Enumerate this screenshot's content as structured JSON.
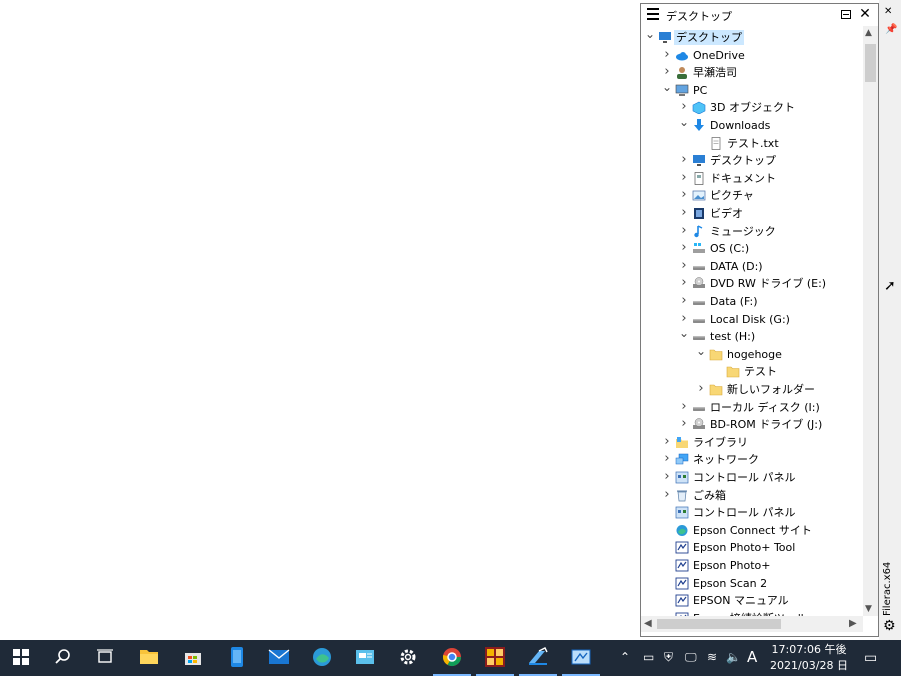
{
  "panel": {
    "title": "デスクトップ"
  },
  "tree": [
    {
      "label": "デスクトップ",
      "depth": 0,
      "chevron": "open",
      "icon": "desktop-icon",
      "selected": true
    },
    {
      "label": "OneDrive",
      "depth": 1,
      "chevron": "closed",
      "icon": "cloud-icon"
    },
    {
      "label": "早瀬浩司",
      "depth": 1,
      "chevron": "closed",
      "icon": "user-icon"
    },
    {
      "label": "PC",
      "depth": 1,
      "chevron": "open",
      "icon": "pc-icon"
    },
    {
      "label": "3D オブジェクト",
      "depth": 2,
      "chevron": "closed",
      "icon": "3d-objects-icon"
    },
    {
      "label": "Downloads",
      "depth": 2,
      "chevron": "open",
      "icon": "download-arrow-icon"
    },
    {
      "label": "テスト.txt",
      "depth": 3,
      "chevron": "none",
      "icon": "text-file-icon"
    },
    {
      "label": "デスクトップ",
      "depth": 2,
      "chevron": "closed",
      "icon": "desktop-icon"
    },
    {
      "label": "ドキュメント",
      "depth": 2,
      "chevron": "closed",
      "icon": "document-icon"
    },
    {
      "label": "ピクチャ",
      "depth": 2,
      "chevron": "closed",
      "icon": "pictures-icon"
    },
    {
      "label": "ビデオ",
      "depth": 2,
      "chevron": "closed",
      "icon": "video-icon"
    },
    {
      "label": "ミュージック",
      "depth": 2,
      "chevron": "closed",
      "icon": "music-icon"
    },
    {
      "label": "OS (C:)",
      "depth": 2,
      "chevron": "closed",
      "icon": "windows-drive-icon"
    },
    {
      "label": "DATA (D:)",
      "depth": 2,
      "chevron": "closed",
      "icon": "drive-icon"
    },
    {
      "label": "DVD RW ドライブ (E:)",
      "depth": 2,
      "chevron": "closed",
      "icon": "dvd-drive-icon"
    },
    {
      "label": "Data (F:)",
      "depth": 2,
      "chevron": "closed",
      "icon": "drive-icon"
    },
    {
      "label": "Local Disk (G:)",
      "depth": 2,
      "chevron": "closed",
      "icon": "drive-icon"
    },
    {
      "label": "test (H:)",
      "depth": 2,
      "chevron": "open",
      "icon": "drive-icon"
    },
    {
      "label": "hogehoge",
      "depth": 3,
      "chevron": "open",
      "icon": "folder-icon"
    },
    {
      "label": "テスト",
      "depth": 4,
      "chevron": "none",
      "icon": "folder-icon"
    },
    {
      "label": "新しいフォルダー",
      "depth": 3,
      "chevron": "closed",
      "icon": "folder-icon"
    },
    {
      "label": "ローカル ディスク (I:)",
      "depth": 2,
      "chevron": "closed",
      "icon": "drive-icon"
    },
    {
      "label": "BD-ROM ドライブ (J:)",
      "depth": 2,
      "chevron": "closed",
      "icon": "dvd-drive-icon"
    },
    {
      "label": "ライブラリ",
      "depth": 1,
      "chevron": "closed",
      "icon": "library-icon"
    },
    {
      "label": "ネットワーク",
      "depth": 1,
      "chevron": "closed",
      "icon": "network-icon"
    },
    {
      "label": "コントロール パネル",
      "depth": 1,
      "chevron": "closed",
      "icon": "control-panel-icon"
    },
    {
      "label": "ごみ箱",
      "depth": 1,
      "chevron": "closed",
      "icon": "recycle-bin-icon"
    },
    {
      "label": "コントロール パネル",
      "depth": 1,
      "chevron": "none",
      "icon": "control-panel-icon"
    },
    {
      "label": "Epson Connect サイト",
      "depth": 1,
      "chevron": "none",
      "icon": "edge-icon"
    },
    {
      "label": "Epson Photo+ Tool",
      "depth": 1,
      "chevron": "none",
      "icon": "epson-app-icon"
    },
    {
      "label": "Epson Photo+",
      "depth": 1,
      "chevron": "none",
      "icon": "epson-app-icon"
    },
    {
      "label": "Epson Scan 2",
      "depth": 1,
      "chevron": "none",
      "icon": "epson-app-icon"
    },
    {
      "label": "EPSON マニュアル",
      "depth": 1,
      "chevron": "none",
      "icon": "epson-app-icon"
    },
    {
      "label": "Epson 接続診断ツール",
      "depth": 1,
      "chevron": "none",
      "icon": "epson-app-icon"
    }
  ],
  "sidestrip": {
    "vertical_label": "Filerac.x64"
  },
  "taskbar": {
    "apps": [
      {
        "name": "start-button",
        "icon": "windows-logo-icon",
        "active": false
      },
      {
        "name": "search-button",
        "icon": "search-icon",
        "active": false
      },
      {
        "name": "task-view-button",
        "icon": "task-view-icon",
        "active": false
      },
      {
        "name": "explorer-button",
        "icon": "folder-icon",
        "active": false
      },
      {
        "name": "store-button",
        "icon": "store-icon",
        "active": false
      },
      {
        "name": "phone-button",
        "icon": "phone-icon",
        "active": false
      },
      {
        "name": "mail-button",
        "icon": "mail-icon",
        "active": false
      },
      {
        "name": "edge-button",
        "icon": "edge-icon",
        "active": false
      },
      {
        "name": "news-button",
        "icon": "news-icon",
        "active": false
      },
      {
        "name": "settings-button",
        "icon": "gear-icon",
        "active": false
      },
      {
        "name": "chrome-button",
        "icon": "chrome-icon",
        "active": true
      },
      {
        "name": "app-grid-button",
        "icon": "grid-app-icon",
        "active": true
      },
      {
        "name": "paint-button",
        "icon": "paint-icon",
        "active": true
      },
      {
        "name": "filerac-button",
        "icon": "filerac-icon",
        "active": true
      }
    ],
    "tray_icons": [
      "chevron-up-icon",
      "tablet-icon",
      "security-icon",
      "display-icon",
      "wifi-icon",
      "volume-icon",
      "ime-icon"
    ],
    "ime_label": "A",
    "time": "17:07:06 午後",
    "date": "2021/03/28 日"
  },
  "colors": {
    "taskbar_bg": "#1f2a38",
    "selection": "#cce8ff",
    "folder": "#f8d775",
    "accent_blue": "#1e88e5"
  }
}
